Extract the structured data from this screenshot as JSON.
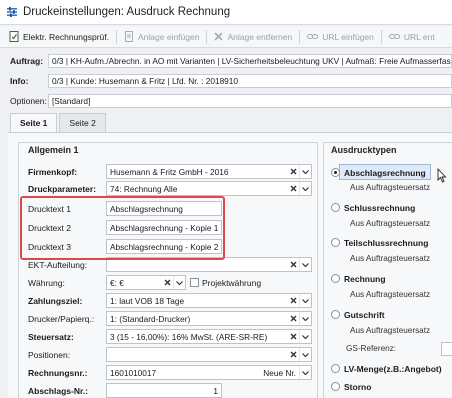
{
  "window": {
    "title": "Druckeinstellungen: Ausdruck Rechnung"
  },
  "toolbar": {
    "buttons": [
      {
        "label": "Elektr. Rechnungsprüf.",
        "icon": "document-check-icon",
        "enabled": true
      },
      {
        "label": "Anlage einfügen",
        "icon": "attachment-icon",
        "enabled": false
      },
      {
        "label": "Anlage entfernen",
        "icon": "remove-icon",
        "enabled": false
      },
      {
        "label": "URL einfügen",
        "icon": "link-icon",
        "enabled": false
      },
      {
        "label": "URL ent",
        "icon": "link-remove-icon",
        "enabled": false
      }
    ]
  },
  "header": {
    "auftrag_label": "Auftrag:",
    "auftrag_value": "0/3 | KH-Aufm./Abrechn. in AO mit Varianten | LV-Sicherheitsbeleuchtung UKV | Aufmaß: Freie Aufmasserfass",
    "info_label": "Info:",
    "info_value": "0/3 | Kunde: Husemann & Fritz | Lfd. Nr. : 2018910",
    "optionen_label": "Optionen:",
    "optionen_value": "[Standard]"
  },
  "tabs": [
    {
      "label": "Seite 1",
      "active": true
    },
    {
      "label": "Seite 2",
      "active": false
    }
  ],
  "allgemein": {
    "title": "Allgemein 1",
    "fields": [
      {
        "label": "Firmenkopf:",
        "bold": true,
        "value": "Husemann & Fritz GmbH - 2016"
      },
      {
        "label": "Druckparameter:",
        "bold": true,
        "value": "74: Rechnung Alle"
      },
      {
        "label": "Drucktext 1",
        "bold": false,
        "value": "Abschlagsrechnung"
      },
      {
        "label": "Drucktext 2",
        "bold": false,
        "value": "Abschlagsrechnung - Kopie 1"
      },
      {
        "label": "Drucktext 3",
        "bold": false,
        "value": "Abschlagsrechnung - Kopie 2"
      },
      {
        "label": "EKT-Aufteilung:",
        "bold": false,
        "value": ""
      },
      {
        "label": "Währung:",
        "bold": false,
        "value": "€: €"
      },
      {
        "label": "Zahlungsziel:",
        "bold": true,
        "value": "1: laut  VOB  18 Tage"
      },
      {
        "label": "Drucker/Papierq.:",
        "bold": false,
        "value": "1: (Standard-Drucker)"
      },
      {
        "label": "Steuersatz:",
        "bold": true,
        "value": "3 (15 - 16,00%): 16% MwSt. (ARE-SR-RE)"
      },
      {
        "label": "Positionen:",
        "bold": false,
        "value": ""
      },
      {
        "label": "Rechnungsnr.:",
        "bold": true,
        "value": "1601010017"
      },
      {
        "label": "Abschlags-Nr.:",
        "bold": true,
        "value": "1"
      }
    ],
    "projektwaehrung_label": "Projektwährung",
    "neu_nr_label": "Neue Nr."
  },
  "ausdrucktypen": {
    "title": "Ausdrucktypen",
    "options": [
      {
        "label": "Abschlagsrechnung",
        "checked": true,
        "sub": "Aus Auftragsteuersatz"
      },
      {
        "label": "Schlussrechnung",
        "checked": false,
        "sub": "Aus Auftragsteuersatz"
      },
      {
        "label": "Teilschlussrechnung",
        "checked": false,
        "sub": "Aus Auftragsteuersatz"
      },
      {
        "label": "Rechnung",
        "checked": false,
        "sub": "Aus Auftragsteuersatz"
      },
      {
        "label": "Gutschrift",
        "checked": false,
        "sub": "Aus Auftragsteuersatz"
      },
      {
        "label": "LV-Menge(z.B.:Angebot)",
        "checked": false,
        "sub": ""
      },
      {
        "label": "Storno",
        "checked": false,
        "sub": ""
      }
    ],
    "gs_referenz_label": "GS-Referenz:"
  },
  "colors": {
    "accent": "#3c78c8",
    "highlight": "#e0474c",
    "selection": "#dfe9f7"
  }
}
